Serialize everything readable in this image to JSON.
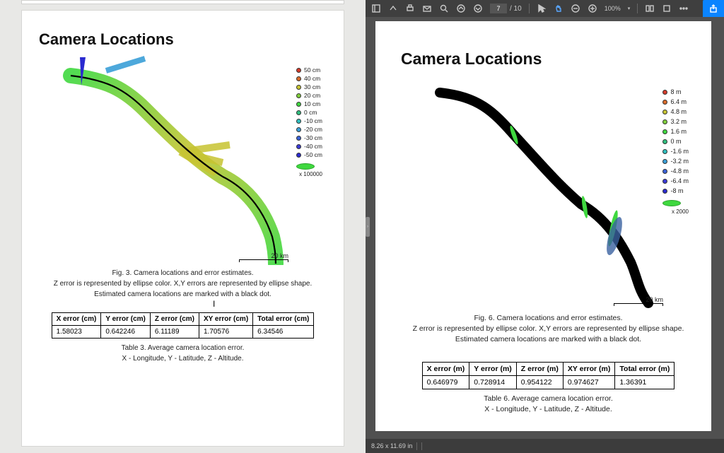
{
  "left": {
    "title": "Camera Locations",
    "legend": {
      "items": [
        {
          "color": "#d43a2a",
          "label": "50 cm"
        },
        {
          "color": "#d96a2a",
          "label": "40 cm"
        },
        {
          "color": "#c7c431",
          "label": "30 cm"
        },
        {
          "color": "#7fcf3a",
          "label": "20 cm"
        },
        {
          "color": "#3fd83f",
          "label": "10 cm"
        },
        {
          "color": "#2fbf7f",
          "label": "0 cm"
        },
        {
          "color": "#2fbfbf",
          "label": "-10 cm"
        },
        {
          "color": "#3a9fd8",
          "label": "-20 cm"
        },
        {
          "color": "#3a62d8",
          "label": "-30 cm"
        },
        {
          "color": "#3a3ad8",
          "label": "-40 cm"
        },
        {
          "color": "#2a2ad0",
          "label": "-50 cm"
        }
      ],
      "ellipse_label": "x 100000"
    },
    "scale": "20 km",
    "fig_caption_1": "Fig. 3. Camera locations and error estimates.",
    "fig_caption_2": "Z error is represented by ellipse color. X,Y errors are represented by ellipse shape.",
    "fig_caption_3": "Estimated camera locations are marked with a black dot.",
    "table_headers": [
      "X error (cm)",
      "Y error (cm)",
      "Z error (cm)",
      "XY error (cm)",
      "Total error (cm)"
    ],
    "table_row": [
      "1.58023",
      "0.642246",
      "6.11189",
      "1.70576",
      "6.34546"
    ],
    "table_caption_1": "Table 3. Average camera location error.",
    "table_caption_2": "X - Longitude, Y - Latitude, Z - Altitude."
  },
  "right": {
    "toolbar": {
      "page_current": "7",
      "page_total": "/ 10",
      "zoom": "100%"
    },
    "status": {
      "dims": "8.26 x 11.69 in"
    },
    "title": "Camera Locations",
    "legend": {
      "items": [
        {
          "color": "#d43a2a",
          "label": "8 m"
        },
        {
          "color": "#d96a2a",
          "label": "6.4 m"
        },
        {
          "color": "#c7c431",
          "label": "4.8 m"
        },
        {
          "color": "#7fcf3a",
          "label": "3.2 m"
        },
        {
          "color": "#3fd83f",
          "label": "1.6 m"
        },
        {
          "color": "#2fbf7f",
          "label": "0 m"
        },
        {
          "color": "#2fbfbf",
          "label": "-1.6 m"
        },
        {
          "color": "#3a9fd8",
          "label": "-3.2 m"
        },
        {
          "color": "#3a62d8",
          "label": "-4.8 m"
        },
        {
          "color": "#3a3ad8",
          "label": "-6.4 m"
        },
        {
          "color": "#2a2ad0",
          "label": "-8 m"
        }
      ],
      "ellipse_label": "x 2000"
    },
    "scale": "20 km",
    "fig_caption_1": "Fig. 6. Camera locations and error estimates.",
    "fig_caption_2": "Z error is represented by ellipse color. X,Y errors are represented by ellipse shape.",
    "fig_caption_3": "Estimated camera locations are marked with a black dot.",
    "table_headers": [
      "X error (m)",
      "Y error (m)",
      "Z error (m)",
      "XY error (m)",
      "Total error (m)"
    ],
    "table_row": [
      "0.646979",
      "0.728914",
      "0.954122",
      "0.974627",
      "1.36391"
    ],
    "table_caption_1": "Table 6. Average camera location error.",
    "table_caption_2": "X - Longitude, Y - Latitude, Z - Altitude."
  }
}
